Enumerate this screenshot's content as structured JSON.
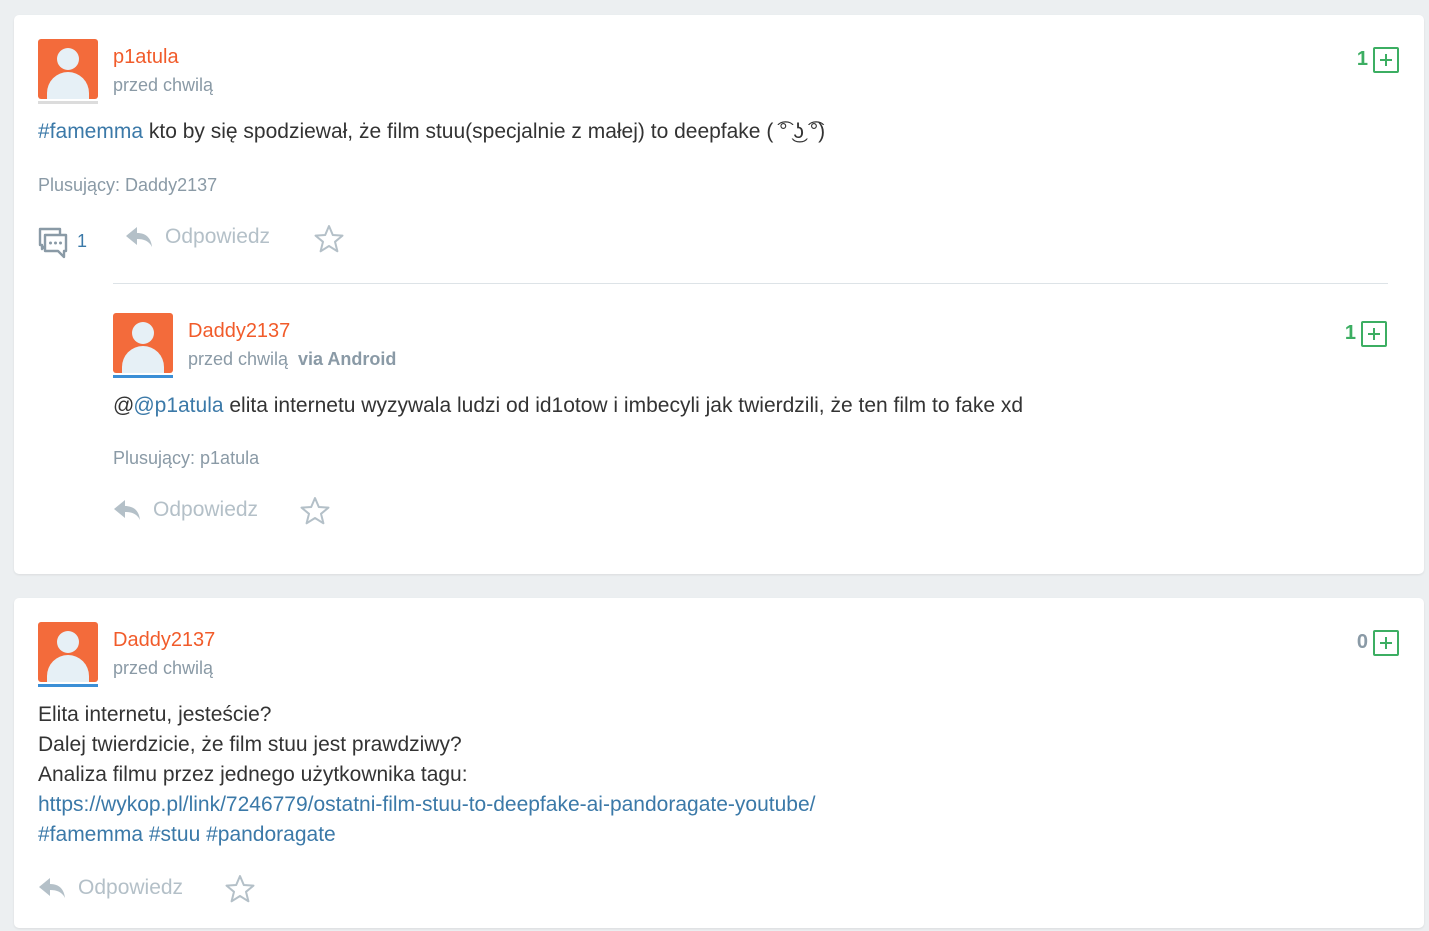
{
  "colors": {
    "accent_orange": "#f15b2a",
    "avatar_bg": "#f36b3b",
    "vote_green": "#3cae62",
    "score_zero": "#8a9aa6",
    "link_blue": "#3b79a8",
    "muted": "#8a9aa6"
  },
  "post1": {
    "username": "p1atula",
    "time": "przed chwilą",
    "score": "1",
    "content_tag": "#famemma",
    "content_text": " kto by się spodziewał, że film stuu(specjalnie z małej) to deepfake ( ͡° ͜ʖ ͡°)",
    "plusers": "Plusujący: Daddy2137",
    "comment_count": "1",
    "reply_label": "Odpowiedz",
    "icons": [
      "comments-icon",
      "reply-icon",
      "star-icon",
      "plus-icon"
    ]
  },
  "reply1": {
    "username": "Daddy2137",
    "time": "przed chwilą",
    "via": "via Android",
    "score": "1",
    "mention": "@p1atula",
    "content_text": " elita internetu wyzywala ludzi od id1otow i imbecyli jak twierdzili, że ten film to fake xd",
    "plusers": "Plusujący: p1atula",
    "reply_label": "Odpowiedz"
  },
  "post2": {
    "username": "Daddy2137",
    "time": "przed chwilą",
    "score": "0",
    "lines": [
      "Elita internetu, jesteście?",
      "Dalej twierdzicie, że film stuu jest prawdziwy?",
      "Analiza filmu przez jednego użytkownika tagu:"
    ],
    "link": "https://wykop.pl/link/7246779/ostatni-film-stuu-to-deepfake-ai-pandoragate-youtube/",
    "tags": [
      "#famemma",
      "#stuu",
      "#pandoragate"
    ],
    "reply_label": "Odpowiedz"
  }
}
